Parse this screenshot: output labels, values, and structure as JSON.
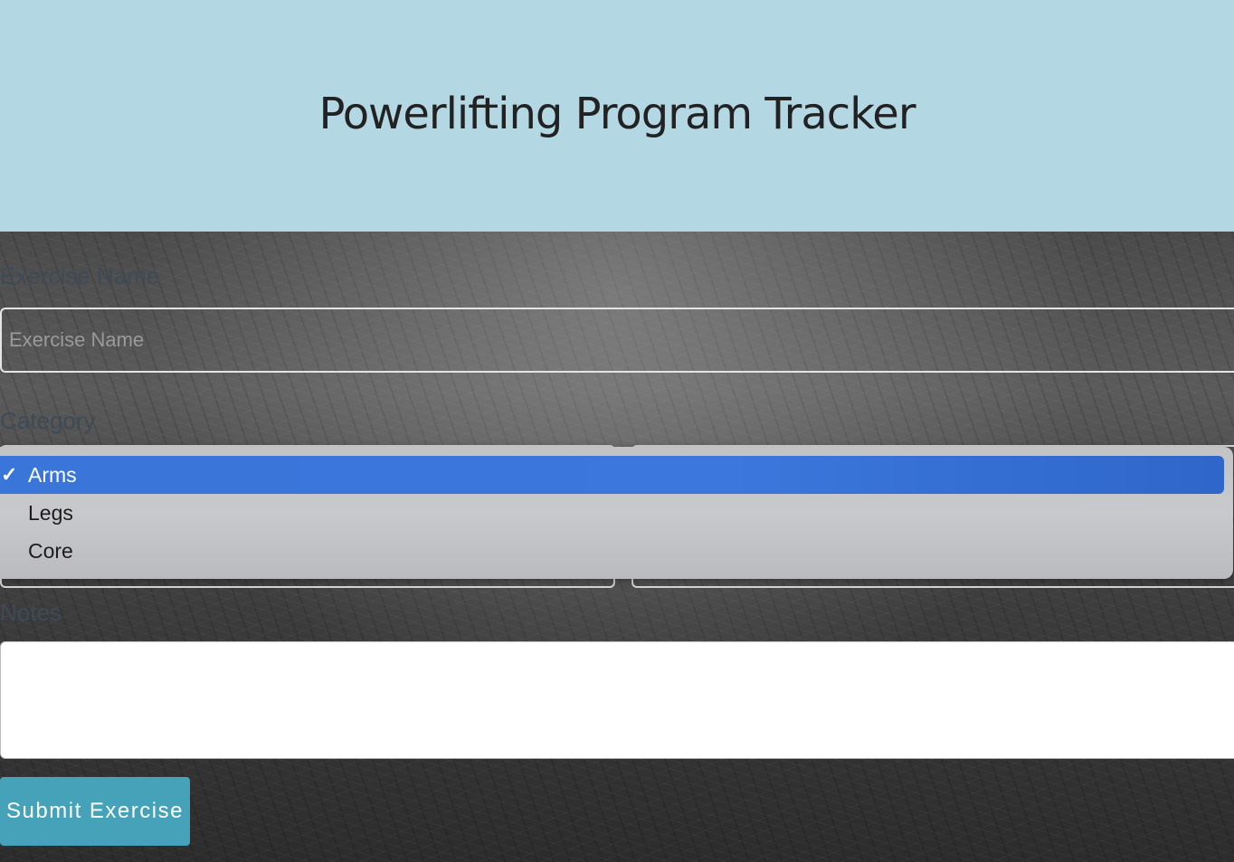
{
  "header": {
    "title": "Powerlifting Program Tracker"
  },
  "form": {
    "exercise_name_label": "Exercise Name",
    "exercise_name_placeholder": "Exercise Name",
    "category_label": "Category",
    "category_dropdown": {
      "options": [
        "Arms",
        "Legs",
        "Core"
      ],
      "selected": "Arms",
      "check_glyph": "✓"
    },
    "notes_label": "Notes",
    "notes_value": "",
    "submit_label": "Submit Exercise"
  },
  "colors": {
    "header_bg": "#b4d8e3",
    "submit_bg": "#45a2b8",
    "selected_option_bg": "#3a75d9"
  }
}
